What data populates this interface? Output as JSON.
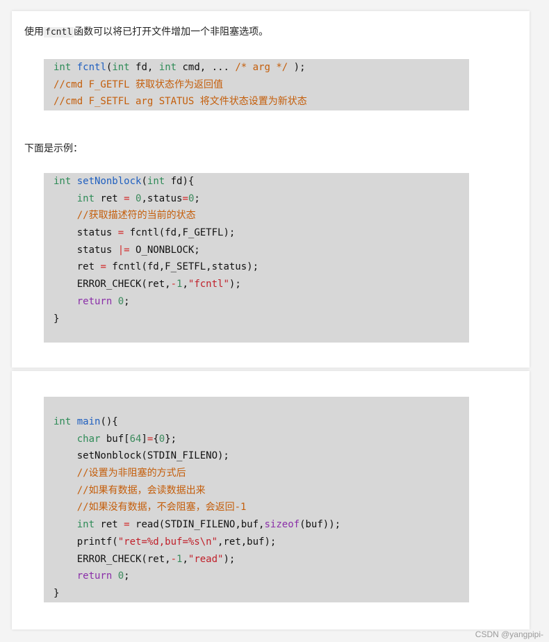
{
  "intro": {
    "before": "使用",
    "code": "fcntl",
    "after": "函数可以将已打开文件增加一个非阻塞选项。"
  },
  "proto": {
    "l1": {
      "int1": "int",
      "fn": "fcntl",
      "p1": "(",
      "int2": "int",
      "p2": " fd, ",
      "int3": "int",
      "p3": " cmd, ... ",
      "cmt": "/* arg */",
      "p4": " );"
    },
    "l2": "//cmd F_GETFL 获取状态作为返回值",
    "l3": "//cmd F_SETFL arg STATUS 将文件状态设置为新状态"
  },
  "example_label": "下面是示例：",
  "snippet1": {
    "l1": {
      "int1": "int",
      "fn": "setNonblock",
      "p1": "(",
      "int2": "int",
      "p2": " fd){"
    },
    "l2": {
      "ind": "    ",
      "int": "int",
      "p1": " ret ",
      "op1": "=",
      "p2": " ",
      "n1": "0",
      "p3": ",status",
      "op2": "=",
      "n2": "0",
      "p4": ";"
    },
    "l3": {
      "ind": "    ",
      "cmt": "//获取描述符的当前的状态"
    },
    "l4": {
      "ind": "    ",
      "p1": "status ",
      "op": "=",
      "p2": " fcntl(fd,F_GETFL);"
    },
    "l5": {
      "ind": "    ",
      "p1": "status ",
      "op": "|=",
      "p2": " O_NONBLOCK;"
    },
    "l6": {
      "ind": "    ",
      "p1": "ret ",
      "op": "=",
      "p2": " fcntl(fd,F_SETFL,status);"
    },
    "l7": {
      "ind": "    ",
      "p1": "ERROR_CHECK(ret,",
      "op": "-",
      "n": "1",
      "p2": ",",
      "str": "\"fcntl\"",
      "p3": ");"
    },
    "l8": {
      "ind": "    ",
      "ret": "return",
      "p1": " ",
      "n": "0",
      "p2": ";"
    },
    "l9": "}"
  },
  "snippet2": {
    "l1": {
      "int": "int",
      "p0": " ",
      "fn": "main",
      "p1": "(){"
    },
    "l2": {
      "ind": "    ",
      "kw": "char",
      "p1": " buf[",
      "n1": "64",
      "p2": "]",
      "op": "=",
      "p3": "{",
      "n2": "0",
      "p4": "};"
    },
    "l3": {
      "ind": "    ",
      "p1": "setNonblock(STDIN_FILENO);"
    },
    "l4": {
      "ind": "    ",
      "cmt": "//设置为非阻塞的方式后"
    },
    "l5": {
      "ind": "    ",
      "cmt": "//如果有数据，会读数据出来"
    },
    "l6": {
      "ind": "    ",
      "cmt": "//如果没有数据，不会阻塞，会返回-1"
    },
    "l7": {
      "ind": "    ",
      "int": "int",
      "p1": " ret ",
      "op": "=",
      "p2": " read(STDIN_FILENO,buf,",
      "kw": "sizeof",
      "p3": "(buf));"
    },
    "l8": {
      "ind": "    ",
      "p1": "printf(",
      "str": "\"ret=%d,buf=%s\\n\"",
      "p2": ",ret,buf);"
    },
    "l9": {
      "ind": "    ",
      "p1": "ERROR_CHECK(ret,",
      "op": "-",
      "n": "1",
      "p2": ",",
      "str": "\"read\"",
      "p3": ");"
    },
    "l10": {
      "ind": "    ",
      "ret": "return",
      "p1": " ",
      "n": "0",
      "p2": ";"
    },
    "l11": "}"
  },
  "watermark": "CSDN @yangpipi-",
  "colors": {
    "code_bg": "#d7d7d7",
    "keyword": "#2e8b57",
    "function": "#1f5fbf",
    "comment": "#c45e0b",
    "string": "#c0202a",
    "control": "#8a2ea8"
  }
}
